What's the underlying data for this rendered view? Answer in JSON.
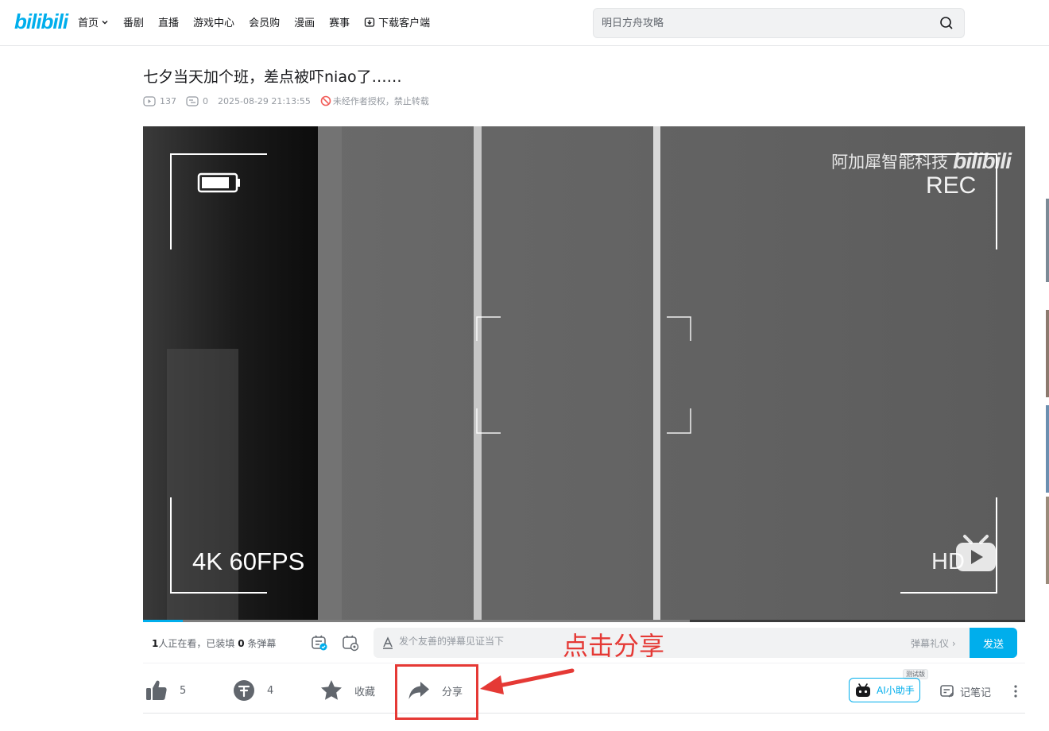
{
  "header": {
    "logo": "bilibili",
    "nav": [
      {
        "label": "首页",
        "dropdown": true
      },
      {
        "label": "番剧"
      },
      {
        "label": "直播"
      },
      {
        "label": "游戏中心"
      },
      {
        "label": "会员购"
      },
      {
        "label": "漫画"
      },
      {
        "label": "赛事"
      },
      {
        "label": "下载客户端"
      }
    ],
    "search": {
      "placeholder": "明日方舟攻略"
    }
  },
  "video": {
    "title": "七夕当天加个班，差点被吓niao了……",
    "play_count": "137",
    "danmaku_count": "0",
    "publish_time": "2025-08-29 21:13:55",
    "copyright_notice": "未经作者授权，禁止转载"
  },
  "player": {
    "watermark_text": "阿加犀智能科技",
    "watermark_logo": "bilibili",
    "rec_label": "REC",
    "fps_label": "4K 60FPS",
    "hd_label": "HD",
    "progress_played": 0.045,
    "progress_buffered": 0.62
  },
  "danmaku_bar": {
    "viewers_prefix": "1",
    "viewers_mid": "人正在看，已装填 ",
    "loaded_count": "0",
    "loaded_suffix": " 条弹幕",
    "input_placeholder": "发个友善的弹幕见证当下",
    "etiquette": "弹幕礼仪 ›",
    "send_label": "发送"
  },
  "annotation": {
    "text": "点击分享",
    "color": "#e53935"
  },
  "toolbar": {
    "like_count": "5",
    "coin_count": "4",
    "favorite_label": "收藏",
    "share_label": "分享",
    "ai_label": "AI小助手",
    "ai_badge": "测试版",
    "note_label": "记笔记"
  },
  "colors": {
    "brand": "#00aeec",
    "icon_gray": "#61666d",
    "annotation_red": "#e53935"
  }
}
